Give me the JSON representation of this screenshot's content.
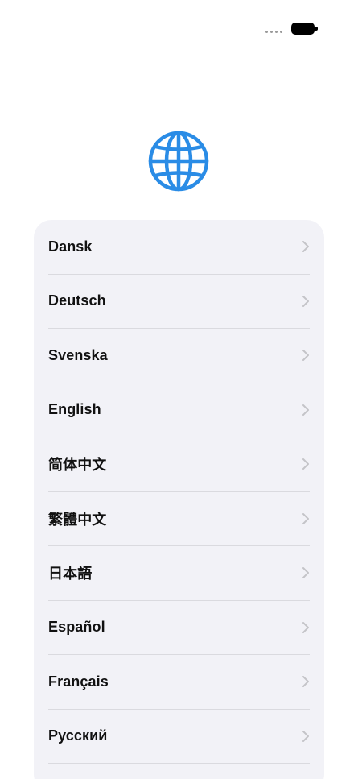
{
  "languages": [
    {
      "label": "Dansk"
    },
    {
      "label": "Deutsch"
    },
    {
      "label": "Svenska"
    },
    {
      "label": "English"
    },
    {
      "label": "简体中文"
    },
    {
      "label": "繁體中文"
    },
    {
      "label": "日本語"
    },
    {
      "label": "Español"
    },
    {
      "label": "Français"
    },
    {
      "label": "Русский"
    }
  ],
  "colors": {
    "accent": "#2a8ce6",
    "card_background": "#f2f2f7",
    "separator": "#dadadf",
    "chevron": "#c4c4c8"
  },
  "icons": {
    "globe": "globe-icon",
    "row_indicator": "chevron-right-icon"
  }
}
